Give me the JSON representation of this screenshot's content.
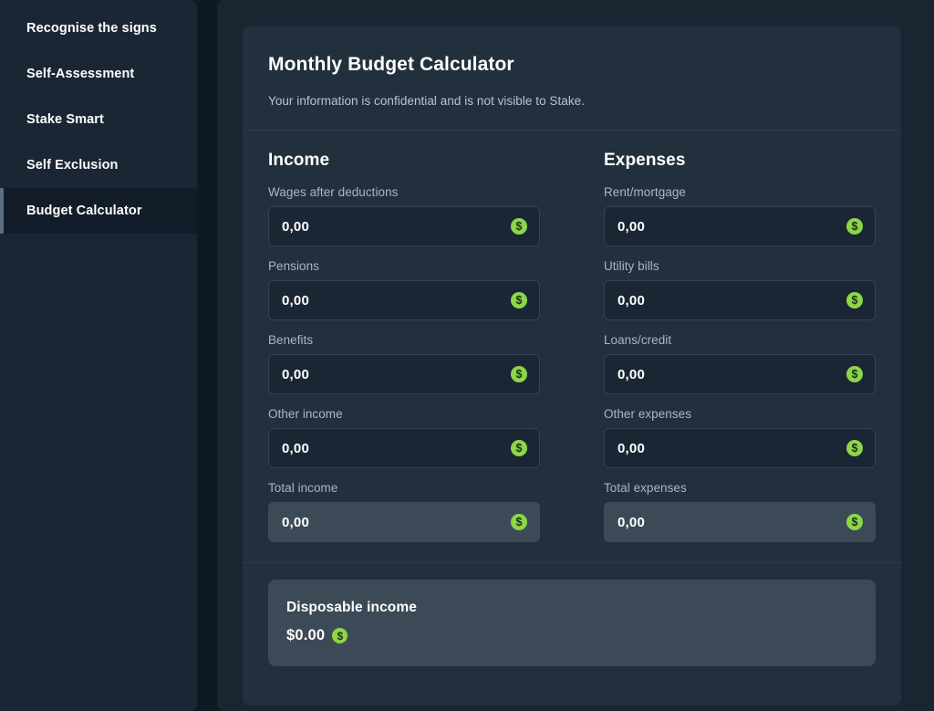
{
  "colors": {
    "page_background": "#0f1923",
    "sidebar_background": "#1a2634",
    "panel_background": "#192531",
    "card_background": "#22303d",
    "input_background": "#1a2633",
    "total_background": "#3c4a58",
    "accent_green": "#8dd648",
    "active_accent": "#5c6f80"
  },
  "sidebar": {
    "items": [
      {
        "label": "Recognise the signs",
        "active": false
      },
      {
        "label": "Self-Assessment",
        "active": false
      },
      {
        "label": "Stake Smart",
        "active": false
      },
      {
        "label": "Self Exclusion",
        "active": false
      },
      {
        "label": "Budget Calculator",
        "active": true
      }
    ]
  },
  "card": {
    "title": "Monthly Budget Calculator",
    "subtitle": "Your information is confidential and is not visible to Stake."
  },
  "income": {
    "heading": "Income",
    "fields": [
      {
        "label": "Wages after deductions",
        "value": "0,00",
        "placeholder": "0,00",
        "total": false
      },
      {
        "label": "Pensions",
        "value": "0,00",
        "placeholder": "0,00",
        "total": false
      },
      {
        "label": "Benefits",
        "value": "0,00",
        "placeholder": "0,00",
        "total": false
      },
      {
        "label": "Other income",
        "value": "0,00",
        "placeholder": "0,00",
        "total": false
      },
      {
        "label": "Total income",
        "value": "0,00",
        "placeholder": "0,00",
        "total": true
      }
    ]
  },
  "expenses": {
    "heading": "Expenses",
    "fields": [
      {
        "label": "Rent/mortgage",
        "value": "0,00",
        "placeholder": "0,00",
        "total": false
      },
      {
        "label": "Utility bills",
        "value": "0,00",
        "placeholder": "0,00",
        "total": false
      },
      {
        "label": "Loans/credit",
        "value": "0,00",
        "placeholder": "0,00",
        "total": false
      },
      {
        "label": "Other expenses",
        "value": "0,00",
        "placeholder": "0,00",
        "total": false
      },
      {
        "label": "Total expenses",
        "value": "0,00",
        "placeholder": "0,00",
        "total": true
      }
    ]
  },
  "disposable": {
    "label": "Disposable income",
    "amount": "$0.00",
    "icon": "dollar-coin-icon"
  },
  "icons": {
    "dollar_glyph": "$",
    "dollar_name": "dollar-coin-icon"
  }
}
